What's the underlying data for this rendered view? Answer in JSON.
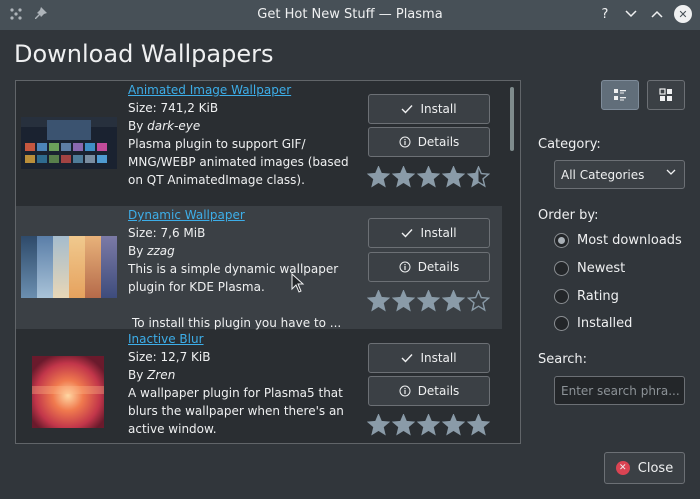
{
  "window": {
    "title": "Get Hot New Stuff — Plasma",
    "buttons": {
      "help": "?",
      "minimize": "∨",
      "maximize": "∧"
    }
  },
  "page_title": "Download Wallpapers",
  "items": [
    {
      "name": "Animated Image Wallpaper",
      "size": "Size: 741,2 KiB",
      "by_prefix": "By ",
      "author": "dark-eye",
      "description": "Plasma plugin to support GIF/ MNG/WEBP animated images (based on QT AnimatedImage class).",
      "install_label": "Install",
      "details_label": "Details",
      "rating_stars": 4.5
    },
    {
      "name": "Dynamic Wallpaper",
      "size": "Size: 7,6 MiB",
      "by_prefix": "By ",
      "author": "zzag",
      "description": "This is a simple dynamic wallpaper plugin for KDE Plasma.",
      "description_extra": "To install this plugin you have to ...",
      "install_label": "Install",
      "details_label": "Details",
      "rating_stars": 4
    },
    {
      "name": "Inactive Blur",
      "size": "Size: 12,7 KiB",
      "by_prefix": "By ",
      "author": "Zren",
      "description": "A wallpaper plugin for Plasma5 that blurs the wallpaper when there's an active window.",
      "install_label": "Install",
      "details_label": "Details",
      "rating_stars": 5
    }
  ],
  "sidebar": {
    "category_label": "Category:",
    "category_value": "All Categories",
    "order_label": "Order by:",
    "order_options": [
      "Most downloads",
      "Newest",
      "Rating",
      "Installed"
    ],
    "order_selected": "Most downloads",
    "search_label": "Search:",
    "search_placeholder": "Enter search phra..."
  },
  "close_label": "Close",
  "colors": {
    "background": "#31363b",
    "link": "#3daee9",
    "star": "#8a9ba8",
    "close_icon": "#da4453"
  }
}
